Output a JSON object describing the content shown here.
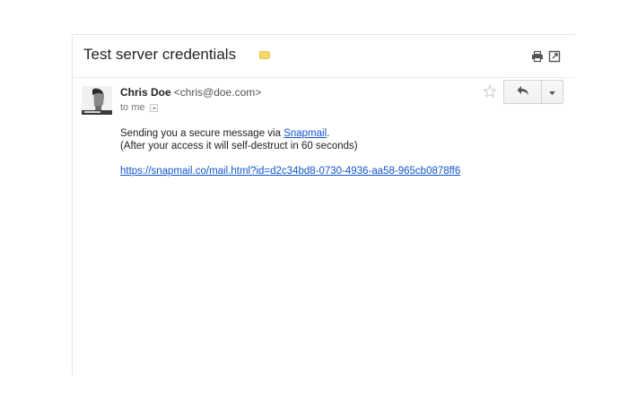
{
  "email": {
    "subject": "Test server credentials",
    "label_color": "#f7d86b",
    "sender": {
      "name": "Chris Doe",
      "email": "<chris@doe.com>"
    },
    "recipient": "to me",
    "body": {
      "line1_prefix": "Sending you a secure message via ",
      "line1_link": "Snapmail",
      "line1_suffix": ".",
      "line2": "(After your access it will self-destruct in 60 seconds)",
      "url": "https://snapmail.co/mail.html?id=d2c34bd8-0730-4936-aa58-965cb0878ff6"
    }
  },
  "icons": {
    "print": "print-icon",
    "new_window": "new-window-icon",
    "star": "star-icon",
    "reply": "reply-icon",
    "more": "chevron-down-icon",
    "details": "chevron-down-icon"
  },
  "colors": {
    "link": "#1155cc",
    "text": "#222222",
    "muted": "#777777"
  }
}
